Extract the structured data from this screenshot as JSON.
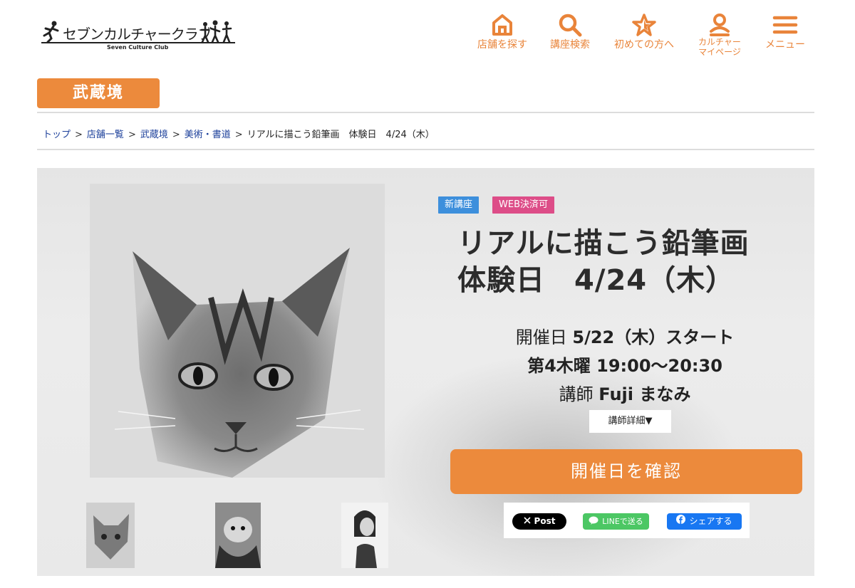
{
  "header": {
    "logo_text": "セブンカルチャークラブ",
    "logo_sub": "Seven Culture Club",
    "nav": [
      {
        "label": "店舗を探す",
        "icon": "home-icon"
      },
      {
        "label": "講座検索",
        "icon": "search-icon"
      },
      {
        "label": "初めての方へ",
        "icon": "star-icon"
      },
      {
        "label_1": "カルチャー",
        "label_2": "マイページ",
        "icon": "user-icon"
      },
      {
        "label": "メニュー",
        "icon": "menu-icon"
      }
    ],
    "accent_color": "#e9843a"
  },
  "store_badge": "武蔵境",
  "breadcrumb": {
    "items": [
      "トップ",
      "店舗一覧",
      "武蔵境",
      "美術・書道"
    ],
    "current": "リアルに描こう鉛筆画　体験日　4/24（木）",
    "separator": ">"
  },
  "course": {
    "tags": [
      "新講座",
      "WEB決済可"
    ],
    "title_line1": "リアルに描こう鉛筆画",
    "title_line2": "体験日　4/24（木）",
    "start_prefix": "開催日",
    "start_value": "5/22（木）スタート",
    "schedule": "第4木曜 19:00〜20:30",
    "instructor_prefix": "講師",
    "instructor_name": "Fuji まなみ",
    "detail_button": "講師詳細▼",
    "cta_button": "開催日を確認"
  },
  "share": {
    "x_label": "Post",
    "line_label": "LINEで送る",
    "fb_label": "シェアする"
  },
  "colors": {
    "orange": "#ec8a3c",
    "tag_blue": "#3d8fdc",
    "tag_pink": "#dd4d88",
    "link": "#1b3f9a"
  }
}
